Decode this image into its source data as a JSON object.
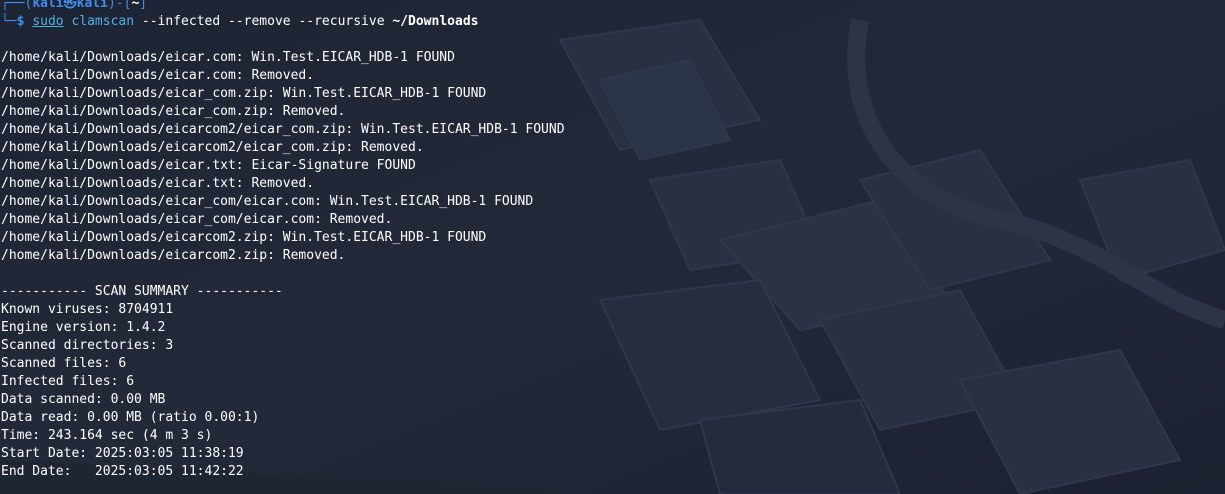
{
  "prompt": {
    "corner_top": "┌──(",
    "user": "kali",
    "at": "㉿",
    "host": "kali",
    "sep": ")-[",
    "dir": "~",
    "close": "]",
    "corner_bottom": "└─",
    "symbol": "$"
  },
  "command": {
    "sudo": "sudo",
    "program": "clamscan",
    "args": "--infected --remove --recursive",
    "path": "~/Downloads"
  },
  "output_lines": [
    "/home/kali/Downloads/eicar.com: Win.Test.EICAR_HDB-1 FOUND",
    "/home/kali/Downloads/eicar.com: Removed.",
    "/home/kali/Downloads/eicar_com.zip: Win.Test.EICAR_HDB-1 FOUND",
    "/home/kali/Downloads/eicar_com.zip: Removed.",
    "/home/kali/Downloads/eicarcom2/eicar_com.zip: Win.Test.EICAR_HDB-1 FOUND",
    "/home/kali/Downloads/eicarcom2/eicar_com.zip: Removed.",
    "/home/kali/Downloads/eicar.txt: Eicar-Signature FOUND",
    "/home/kali/Downloads/eicar.txt: Removed.",
    "/home/kali/Downloads/eicar_com/eicar.com: Win.Test.EICAR_HDB-1 FOUND",
    "/home/kali/Downloads/eicar_com/eicar.com: Removed.",
    "/home/kali/Downloads/eicarcom2.zip: Win.Test.EICAR_HDB-1 FOUND",
    "/home/kali/Downloads/eicarcom2.zip: Removed."
  ],
  "summary": {
    "header": "----------- SCAN SUMMARY -----------",
    "lines": [
      "Known viruses: 8704911",
      "Engine version: 1.4.2",
      "Scanned directories: 3",
      "Scanned files: 6",
      "Infected files: 6",
      "Data scanned: 0.00 MB",
      "Data read: 0.00 MB (ratio 0.00:1)",
      "Time: 243.164 sec (4 m 3 s)",
      "Start Date: 2025:03:05 11:38:19",
      "End Date:   2025:03:05 11:42:22"
    ]
  },
  "colors": {
    "background": "#1f2635",
    "prompt_blue": "#3b8eea",
    "text": "#ffffff"
  }
}
